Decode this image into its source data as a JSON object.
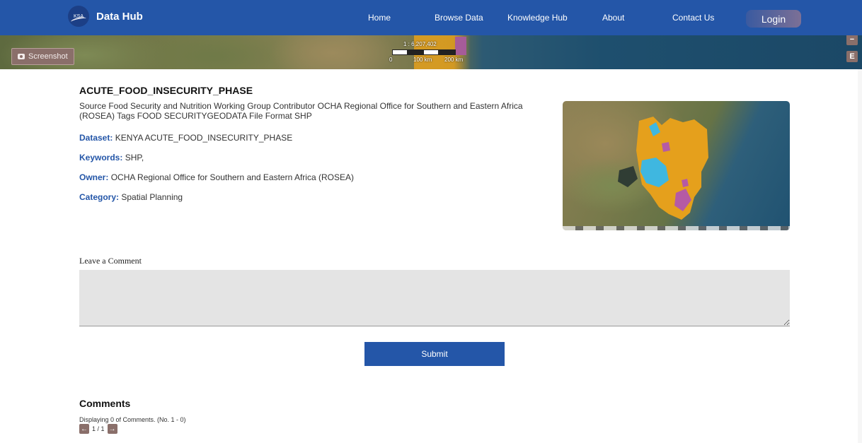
{
  "nav": {
    "logo_text": "KSA",
    "brand": "Data Hub",
    "links": [
      "Home",
      "Browse Data",
      "Knowledge Hub",
      "About",
      "Contact Us"
    ],
    "login": "Login"
  },
  "map": {
    "screenshot_button": "Screenshot",
    "scale_ratio": "1 : 6,207,402",
    "scale_labels": [
      "0",
      "100 km",
      "200 km"
    ],
    "zoom_out": "−",
    "extent_button": "E"
  },
  "dataset": {
    "title": "ACUTE_FOOD_INSECURITY_PHASE",
    "description": "Source Food Security and Nutrition Working Group Contributor OCHA Regional Office for Southern and Eastern Africa (ROSEA) Tags FOOD SECURITYGEODATA File Format SHP",
    "fields": [
      {
        "key": "Dataset:",
        "value": "KENYA ACUTE_FOOD_INSECURITY_PHASE"
      },
      {
        "key": "Keywords:",
        "value": "SHP,"
      },
      {
        "key": "Owner:",
        "value": "OCHA Regional Office for Southern and Eastern Africa (ROSEA)"
      },
      {
        "key": "Category:",
        "value": "Spatial Planning"
      }
    ]
  },
  "comment_form": {
    "label": "Leave a Comment",
    "value": "",
    "submit": "Submit"
  },
  "comments": {
    "heading": "Comments",
    "count_text": "Displaying 0 of Comments. (No. 1 - 0)",
    "page_indicator": "1 / 1",
    "prev_icon": "arrow-left-icon",
    "next_icon": "arrow-right-icon"
  },
  "colors": {
    "brand_blue": "#2456a8",
    "phase_orange": "#e5a01c",
    "phase_cyan": "#3fb7e0",
    "phase_purple": "#b55aa5",
    "button_taupe": "#8a6f6a"
  }
}
